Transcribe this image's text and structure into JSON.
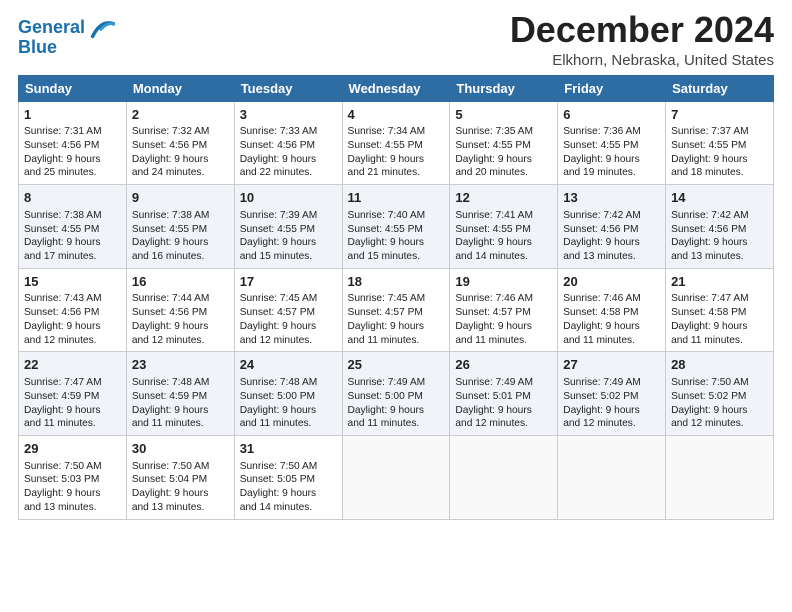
{
  "logo": {
    "line1": "General",
    "line2": "Blue"
  },
  "title": "December 2024",
  "location": "Elkhorn, Nebraska, United States",
  "days_header": [
    "Sunday",
    "Monday",
    "Tuesday",
    "Wednesday",
    "Thursday",
    "Friday",
    "Saturday"
  ],
  "weeks": [
    [
      {
        "day": "1",
        "info": "Sunrise: 7:31 AM\nSunset: 4:56 PM\nDaylight: 9 hours\nand 25 minutes."
      },
      {
        "day": "2",
        "info": "Sunrise: 7:32 AM\nSunset: 4:56 PM\nDaylight: 9 hours\nand 24 minutes."
      },
      {
        "day": "3",
        "info": "Sunrise: 7:33 AM\nSunset: 4:56 PM\nDaylight: 9 hours\nand 22 minutes."
      },
      {
        "day": "4",
        "info": "Sunrise: 7:34 AM\nSunset: 4:55 PM\nDaylight: 9 hours\nand 21 minutes."
      },
      {
        "day": "5",
        "info": "Sunrise: 7:35 AM\nSunset: 4:55 PM\nDaylight: 9 hours\nand 20 minutes."
      },
      {
        "day": "6",
        "info": "Sunrise: 7:36 AM\nSunset: 4:55 PM\nDaylight: 9 hours\nand 19 minutes."
      },
      {
        "day": "7",
        "info": "Sunrise: 7:37 AM\nSunset: 4:55 PM\nDaylight: 9 hours\nand 18 minutes."
      }
    ],
    [
      {
        "day": "8",
        "info": "Sunrise: 7:38 AM\nSunset: 4:55 PM\nDaylight: 9 hours\nand 17 minutes."
      },
      {
        "day": "9",
        "info": "Sunrise: 7:38 AM\nSunset: 4:55 PM\nDaylight: 9 hours\nand 16 minutes."
      },
      {
        "day": "10",
        "info": "Sunrise: 7:39 AM\nSunset: 4:55 PM\nDaylight: 9 hours\nand 15 minutes."
      },
      {
        "day": "11",
        "info": "Sunrise: 7:40 AM\nSunset: 4:55 PM\nDaylight: 9 hours\nand 15 minutes."
      },
      {
        "day": "12",
        "info": "Sunrise: 7:41 AM\nSunset: 4:55 PM\nDaylight: 9 hours\nand 14 minutes."
      },
      {
        "day": "13",
        "info": "Sunrise: 7:42 AM\nSunset: 4:56 PM\nDaylight: 9 hours\nand 13 minutes."
      },
      {
        "day": "14",
        "info": "Sunrise: 7:42 AM\nSunset: 4:56 PM\nDaylight: 9 hours\nand 13 minutes."
      }
    ],
    [
      {
        "day": "15",
        "info": "Sunrise: 7:43 AM\nSunset: 4:56 PM\nDaylight: 9 hours\nand 12 minutes."
      },
      {
        "day": "16",
        "info": "Sunrise: 7:44 AM\nSunset: 4:56 PM\nDaylight: 9 hours\nand 12 minutes."
      },
      {
        "day": "17",
        "info": "Sunrise: 7:45 AM\nSunset: 4:57 PM\nDaylight: 9 hours\nand 12 minutes."
      },
      {
        "day": "18",
        "info": "Sunrise: 7:45 AM\nSunset: 4:57 PM\nDaylight: 9 hours\nand 11 minutes."
      },
      {
        "day": "19",
        "info": "Sunrise: 7:46 AM\nSunset: 4:57 PM\nDaylight: 9 hours\nand 11 minutes."
      },
      {
        "day": "20",
        "info": "Sunrise: 7:46 AM\nSunset: 4:58 PM\nDaylight: 9 hours\nand 11 minutes."
      },
      {
        "day": "21",
        "info": "Sunrise: 7:47 AM\nSunset: 4:58 PM\nDaylight: 9 hours\nand 11 minutes."
      }
    ],
    [
      {
        "day": "22",
        "info": "Sunrise: 7:47 AM\nSunset: 4:59 PM\nDaylight: 9 hours\nand 11 minutes."
      },
      {
        "day": "23",
        "info": "Sunrise: 7:48 AM\nSunset: 4:59 PM\nDaylight: 9 hours\nand 11 minutes."
      },
      {
        "day": "24",
        "info": "Sunrise: 7:48 AM\nSunset: 5:00 PM\nDaylight: 9 hours\nand 11 minutes."
      },
      {
        "day": "25",
        "info": "Sunrise: 7:49 AM\nSunset: 5:00 PM\nDaylight: 9 hours\nand 11 minutes."
      },
      {
        "day": "26",
        "info": "Sunrise: 7:49 AM\nSunset: 5:01 PM\nDaylight: 9 hours\nand 12 minutes."
      },
      {
        "day": "27",
        "info": "Sunrise: 7:49 AM\nSunset: 5:02 PM\nDaylight: 9 hours\nand 12 minutes."
      },
      {
        "day": "28",
        "info": "Sunrise: 7:50 AM\nSunset: 5:02 PM\nDaylight: 9 hours\nand 12 minutes."
      }
    ],
    [
      {
        "day": "29",
        "info": "Sunrise: 7:50 AM\nSunset: 5:03 PM\nDaylight: 9 hours\nand 13 minutes."
      },
      {
        "day": "30",
        "info": "Sunrise: 7:50 AM\nSunset: 5:04 PM\nDaylight: 9 hours\nand 13 minutes."
      },
      {
        "day": "31",
        "info": "Sunrise: 7:50 AM\nSunset: 5:05 PM\nDaylight: 9 hours\nand 14 minutes."
      },
      {
        "day": "",
        "info": ""
      },
      {
        "day": "",
        "info": ""
      },
      {
        "day": "",
        "info": ""
      },
      {
        "day": "",
        "info": ""
      }
    ]
  ]
}
